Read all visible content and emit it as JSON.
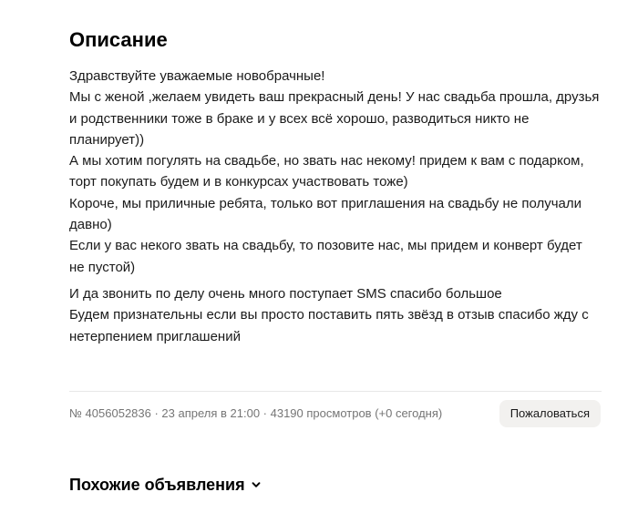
{
  "description": {
    "title": "Описание",
    "paragraphs": [
      [
        "Здравствуйте уважаемые новобрачные!",
        "Мы с женой ,желаем увидеть ваш прекрасный день! У нас свадьба прошла, друзья",
        "и родственники тоже в браке и у всех всё хорошо, разводиться никто не",
        "планирует))",
        "А мы хотим погулять на свадьбе, но звать нас некому! придем к вам с подарком,",
        "торт покупать будем и в конкурсах участвовать тоже)",
        "Короче, мы приличные ребята, только вот приглашения на свадьбу не получали",
        "давно)",
        "Если у вас некого звать на свадьбу, то позовите нас, мы придем и конверт будет",
        "не пустой)"
      ],
      [
        "И да звонить по делу очень много поступает SMS спасибо большое",
        "Будем признательны если вы просто поставить пять звёзд в отзыв спасибо жду с",
        "нетерпением приглашений"
      ]
    ]
  },
  "meta": {
    "info": "№ 4056052836 · 23 апреля в 21:00 · 43190 просмотров (+0 сегодня)",
    "report_label": "Пожаловаться"
  },
  "similar": {
    "title": "Похожие объявления",
    "icon": "chevron-down-icon"
  }
}
